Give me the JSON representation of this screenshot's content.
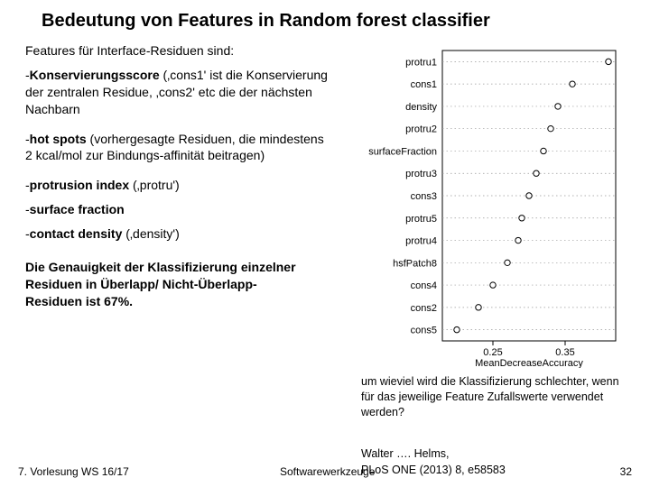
{
  "title": "Bedeutung von Features in Random forest classifier",
  "intro": "Features für Interface-Residuen sind:",
  "bullets": {
    "b1_lead": "Konservierungsscore",
    "b1_rest": " (‚cons1' ist die Konservierung der zentralen Residue, ‚cons2' etc die der nächsten Nachbarn",
    "b2_lead": "hot spots",
    "b2_rest": " (vorhergesagte Residuen, die mindestens 2 kcal/mol zur Bindungs-affinität beitragen)",
    "b3_lead": "protrusion index",
    "b3_rest": " (‚protru')",
    "b4_lead": "surface fraction",
    "b5_lead": "contact density",
    "b5_rest": " (‚density')"
  },
  "conclusion": "Die Genauigkeit der Klassifizierung einzelner Residuen in Überlapp/ Nicht-Überlapp-Residuen ist 67%.",
  "caption": "um wieviel wird die Klassifizierung schlechter, wenn für das jeweilige Feature Zufallswerte verwendet werden?",
  "citation_a": "Walter …. Helms,",
  "citation_b": "PLoS ONE (2013) 8, e58583",
  "footer": {
    "left": "7. Vorlesung WS 16/17",
    "center": "Softwarewerkzeuge",
    "page": "32"
  },
  "chart_data": {
    "type": "dot",
    "title": "",
    "xlabel": "MeanDecreaseAccuracy",
    "ylabel": "",
    "xticks": [
      0.25,
      0.35
    ],
    "xlim": [
      0.18,
      0.42
    ],
    "features": [
      {
        "name": "protru1",
        "value": 0.41
      },
      {
        "name": "cons1",
        "value": 0.36
      },
      {
        "name": "density",
        "value": 0.34
      },
      {
        "name": "protru2",
        "value": 0.33
      },
      {
        "name": "surfaceFraction",
        "value": 0.32
      },
      {
        "name": "protru3",
        "value": 0.31
      },
      {
        "name": "cons3",
        "value": 0.3
      },
      {
        "name": "protru5",
        "value": 0.29
      },
      {
        "name": "protru4",
        "value": 0.285
      },
      {
        "name": "hsfPatch8",
        "value": 0.27
      },
      {
        "name": "cons4",
        "value": 0.25
      },
      {
        "name": "cons2",
        "value": 0.23
      },
      {
        "name": "cons5",
        "value": 0.2
      }
    ]
  }
}
